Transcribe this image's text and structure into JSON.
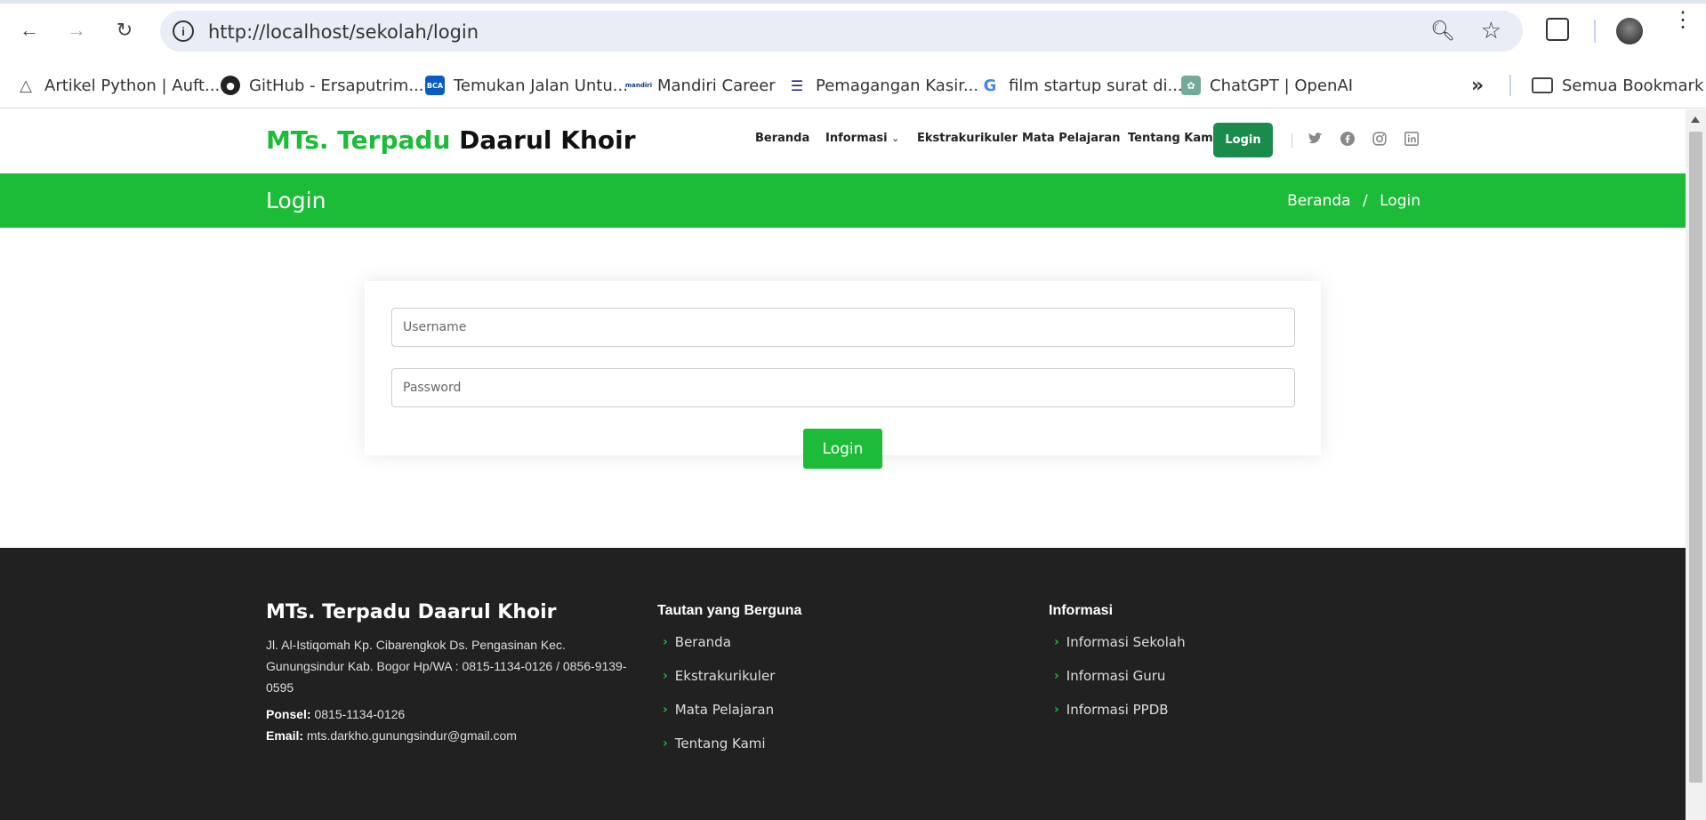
{
  "browser": {
    "url": "http://localhost/sekolah/login",
    "bookmarks": [
      {
        "label": "Artikel Python | Auft..."
      },
      {
        "label": "GitHub - Ersaputrim..."
      },
      {
        "label": "Temukan Jalan Untu..."
      },
      {
        "label": "Mandiri Career"
      },
      {
        "label": "Pemagangan Kasir..."
      },
      {
        "label": "film startup surat di..."
      },
      {
        "label": "ChatGPT | OpenAI"
      }
    ],
    "more_bookmarks": "»",
    "all_bookmarks_label": "Semua Bookmark"
  },
  "header": {
    "logo_part1": "MTs. Terpadu",
    "logo_part2": "Daarul Khoir",
    "nav": {
      "home": "Beranda",
      "info": "Informasi",
      "extra": "Ekstrakurikuler",
      "subjects": "Mata Pelajaran",
      "about": "Tentang Kami",
      "login": "Login"
    }
  },
  "banner": {
    "title": "Login",
    "crumb_home": "Beranda",
    "crumb_sep": "/",
    "crumb_current": "Login"
  },
  "form": {
    "username_placeholder": "Username",
    "password_placeholder": "Password",
    "submit_label": "Login"
  },
  "footer": {
    "brand": "MTs. Terpadu Daarul Khoir",
    "address": "Jl. Al-Istiqomah Kp. Cibarengkok Ds. Pengasinan Kec. Gunungsindur Kab. Bogor Hp/WA : 0815-1134-0126 / 0856-9139-0595",
    "phone_label": "Ponsel:",
    "phone": "0815-1134-0126",
    "email_label": "Email:",
    "email": "mts.darkho.gunungsindur@gmail.com",
    "links_heading": "Tautan yang Berguna",
    "links": [
      "Beranda",
      "Ekstrakurikuler",
      "Mata Pelajaran",
      "Tentang Kami"
    ],
    "info_heading": "Informasi",
    "info_links": [
      "Informasi Sekolah",
      "Informasi Guru",
      "Informasi PPDB"
    ]
  },
  "colors": {
    "brand_green": "#1cbb38",
    "nav_login_bg": "#1a8b4b",
    "footer_bg": "#212121"
  }
}
